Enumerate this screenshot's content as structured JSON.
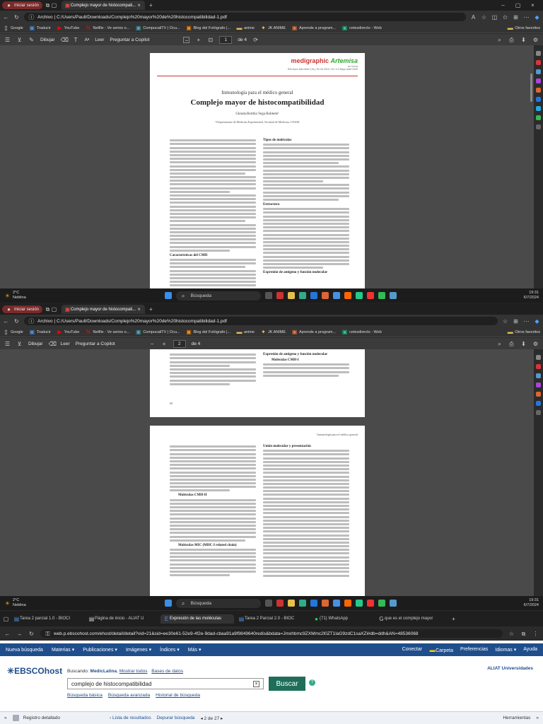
{
  "screen1": {
    "tab_session": "Iniciar sesión",
    "tab_pdf": "Complejo mayor de histocompati...",
    "address": "Archivo  |  C:/Users/Paull/Downloads/Complejo%20mayor%20de%20histocompatibilidad-1.pdf",
    "bookmarks": [
      "Google",
      "Traducir",
      "YouTube",
      "Netflix - Ve series o...",
      "CompucaliTV | Ocu...",
      "Blog del Fotógrafo |...",
      "anime",
      "JK ANIME",
      "Aprende a program...",
      "cetesdirecto - Web"
    ],
    "bookmarks_more": "Otros favoritos",
    "toolbar": {
      "draw": "Dibujar",
      "aa": "Aᵃ",
      "read": "Leer",
      "ask": "Preguntar a Copilot",
      "page": "1",
      "of": "de 4"
    },
    "doc": {
      "logo": "medigraphic",
      "logo2": "Artemisa",
      "logo_sub": "en línea",
      "ref": "Rev Asoc Mex Med Crit y Ter Int 2010; Vol. 3-2 Mayo-Abril 2009",
      "section": "Inmunología para el médico general",
      "title": "Complejo mayor de histocompatibilidad",
      "author": "Glenda Berthia Vega Robledo¹",
      "affil": "¹ Departamento de Medicina Experimental, Facultad de Medicina, UNAM.",
      "h_char": "Características del CMH",
      "h_tipos": "Tipos de moléculas",
      "h_estr": "Estructura",
      "h_expr": "Expresión de antígeno y función molecular"
    },
    "weather": {
      "temp": "2°C",
      "cond": "Neblina"
    },
    "search": "Búsqueda",
    "clock": {
      "time": "19:31",
      "date": "6/7/2024"
    }
  },
  "screen2": {
    "tab_session": "Iniciar sesión",
    "tab_pdf": "Complejo mayor de histocompati...",
    "address": "Archivo  |  C:/Users/Paull/Downloads/Complejo%20mayor%20de%20histocompatibilidad-1.pdf",
    "toolbar": {
      "draw": "Dibujar",
      "read": "Leer",
      "ask": "Preguntar a Copilot",
      "page": "2",
      "of": "de 4"
    },
    "doc": {
      "expr": "Expresión de antígeno y función molecular",
      "mol1": "Moléculas CMH-I",
      "pagenum": "68",
      "running": "Inmunología para el médico general",
      "mol2": "Moléculas CMH-II",
      "mic": "Moléculas MIC (MHC-I related chain)",
      "union": "Unión molecular y presentación"
    },
    "weather": {
      "temp": "2°C",
      "cond": "Neblina"
    },
    "search": "Búsqueda",
    "clock": {
      "time": "19:31",
      "date": "6/7/2024"
    }
  },
  "screen3": {
    "tabs": [
      "Tarea 2 parcial 1.0 - BIOCI",
      "Página de inicio - ALIAT U",
      "Expresión de las moléculas",
      "Tarea 2 Parcial 2.0 - BIOC",
      "(71) WhatsApp",
      "que es el complejo mayor"
    ],
    "url": "web.p.ebscohost.com/ehost/detail/detail?vid=21&sid=ee30e61-52e9-4f2e-9dad-cbaa91a9f9849640redis&bdata=Jmxhbmc9ZXMmc2l0ZT1laG9zdC1saXZl#db=ddh&AN=48536068",
    "nav": [
      "Nueva búsqueda",
      "Materias",
      "Publicaciones",
      "Imágenes",
      "Índices",
      "Más"
    ],
    "nav_right": [
      "Conectar",
      "Carpeta",
      "Preferencias",
      "Idiomas",
      "Ayuda"
    ],
    "logo": "EBSCOhost",
    "searching_label": "Buscando:",
    "db_name": "MedicLatina",
    "show_all": "Mostrar todos",
    "db_link": "Bases de datos",
    "query": "complejo de histocompatibilidad",
    "btn": "Buscar",
    "links": [
      "Búsqueda básica",
      "Búsqueda avanzada",
      "Historial de búsqueda"
    ],
    "inst": "ALIAT Universidades",
    "detail": "Registro detallado",
    "results": "Lista de resultados",
    "refine": "Depurar búsqueda",
    "pager": "2 de 27",
    "tools": "Herramientas"
  }
}
